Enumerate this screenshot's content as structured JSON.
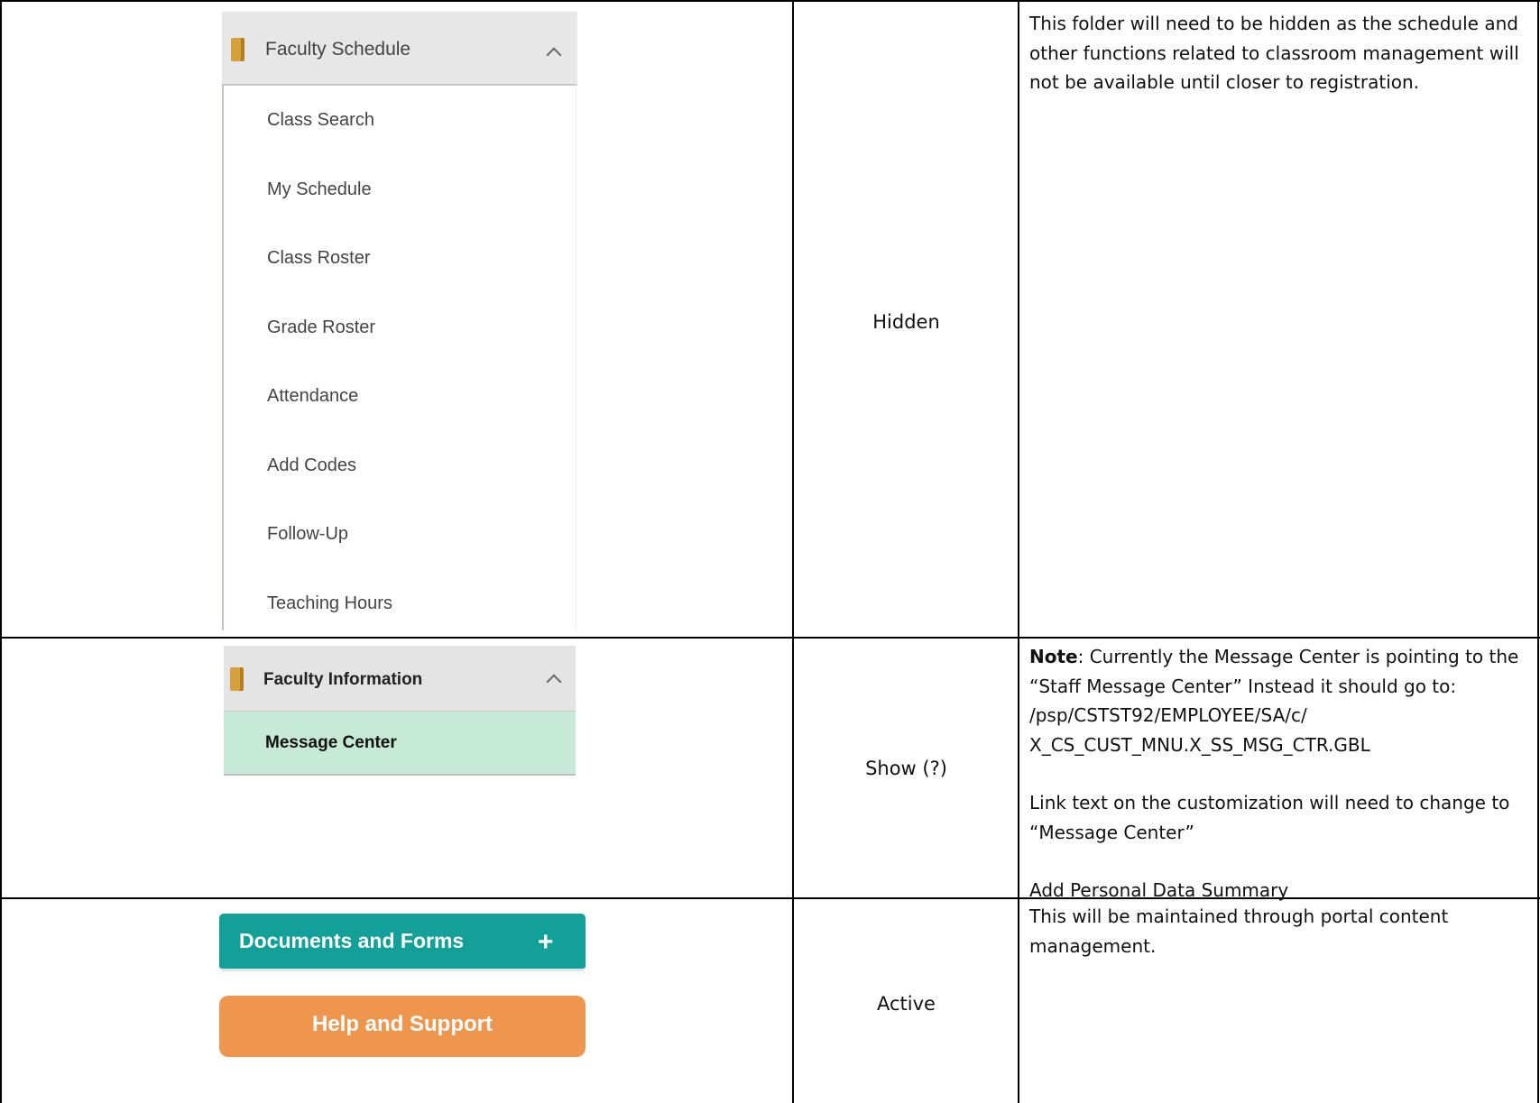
{
  "rows": [
    {
      "faculty_schedule_menu": {
        "header": "Faculty Schedule",
        "folder_icon": "folder-icon",
        "toggle_icon": "chevron-up-icon",
        "items": [
          "Class Search",
          "My Schedule",
          "Class Roster",
          "Grade Roster",
          "Attendance",
          "Add Codes",
          "Follow-Up",
          "Teaching Hours"
        ]
      },
      "status": "Hidden",
      "notes": "This folder will need to be hidden as the schedule and other functions related to classroom management will not be available until closer to registration."
    },
    {
      "faculty_information_menu": {
        "header": "Faculty Information",
        "folder_icon": "folder-icon",
        "toggle_icon": "chevron-up-icon",
        "items": [
          "Message Center"
        ],
        "selected_item_bg": "#c7e9d7"
      },
      "status": "Show (?)",
      "notes_note_label": "Note",
      "notes_note_text": ": Currently the Message Center is pointing to the “Staff Message Center” Instead it should go to:",
      "notes_path_1": "/psp/CSTST92/EMPLOYEE/SA/c/",
      "notes_path_2": "X_CS_CUST_MNU.X_SS_MSG_CTR.GBL",
      "notes_link_text": "Link text on the customization will need to change to “Message Center”",
      "notes_add": "Add Personal Data Summary"
    },
    {
      "documents_button": {
        "label": "Documents and Forms",
        "icon": "plus-icon",
        "color": "#12a098"
      },
      "help_button": {
        "label": "Help and Support",
        "color": "#ef964e"
      },
      "status": "Active",
      "notes": "This will be maintained through portal content management."
    }
  ]
}
